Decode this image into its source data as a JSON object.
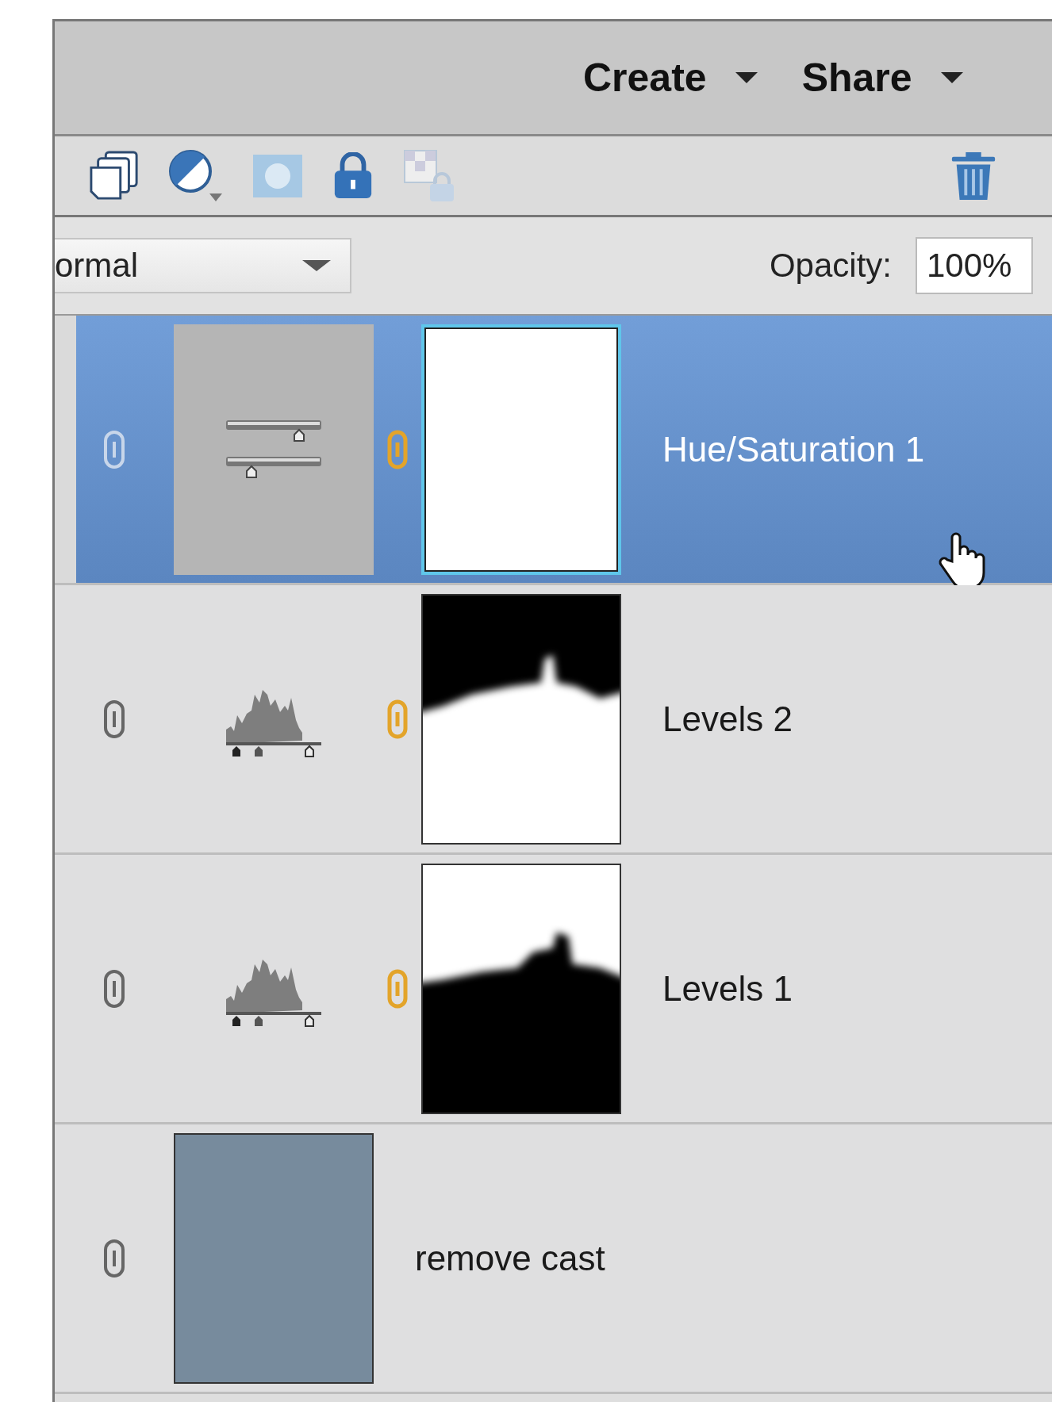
{
  "menu": [
    {
      "label": "Create"
    },
    {
      "label": "Share"
    }
  ],
  "blend_mode": {
    "value": "ormal"
  },
  "opacity": {
    "label": "Opacity:",
    "value": "100%"
  },
  "layers": [
    {
      "name": "Hue/Saturation 1",
      "kind": "hue-saturation",
      "selected": true,
      "mask": {
        "kind": "blank"
      }
    },
    {
      "name": "Levels 2",
      "kind": "levels",
      "selected": false,
      "mask": {
        "kind": "top-dark"
      }
    },
    {
      "name": "Levels 1",
      "kind": "levels",
      "selected": false,
      "mask": {
        "kind": "bottom-dark"
      }
    },
    {
      "name": "remove cast",
      "kind": "fill",
      "selected": false,
      "color": "#778b9d"
    }
  ]
}
